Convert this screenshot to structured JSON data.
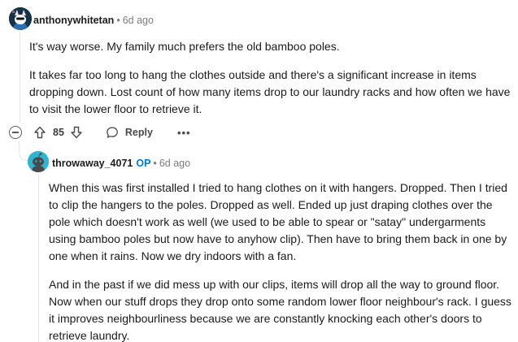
{
  "comment": {
    "username": "anthonywhitetan",
    "separator": "•",
    "time": "6d ago",
    "paragraphs": [
      "It's way worse. My family much prefers the old bamboo poles.",
      "It takes far too long to hang the clothes outside and there's a significant increase in items dropping down. Lost count of how many items drop to our laundry racks and how often we have to visit the lower floor to retrieve it."
    ],
    "votes": "85",
    "reply_label": "Reply",
    "more_label": "•••"
  },
  "reply": {
    "username": "throwaway_4071",
    "op_badge": "OP",
    "separator": "•",
    "time": "6d ago",
    "paragraphs": [
      "When this was first installed I tried to hang clothes on it with hangers. Dropped. Then I tried to clip the hangers to the poles. Dropped as well. Ended up just draping clothes over the pole which doesn't work as well (we used to be able to spear or \"satay\" undergarments using bamboo poles but now have to anyhow clip). Then have to bring them back in one by one when it rains. Now we dry indoors with a fan.",
      "And in the past if we did mess up with our clips, items will drop all the way to ground floor. Now when our stuff drops they drop onto some random lower floor neighbour's rack. I guess it improves neighbourliness because we are constantly knocking each other's doors to retrieve laundry."
    ]
  },
  "icons": {
    "avatar1": "snoo-avatar-icon",
    "avatar2": "snoo-avatar-icon",
    "collapse": "collapse-thread-icon",
    "upvote": "upvote-arrow-icon",
    "downvote": "downvote-arrow-icon",
    "reply": "comment-bubble-icon"
  },
  "colors": {
    "op_badge": "#0079d3",
    "avatar2_bg": "#2fb5d2",
    "avatar1_bg": "#1c2a3a",
    "thread_line": "#e5e5e5"
  }
}
